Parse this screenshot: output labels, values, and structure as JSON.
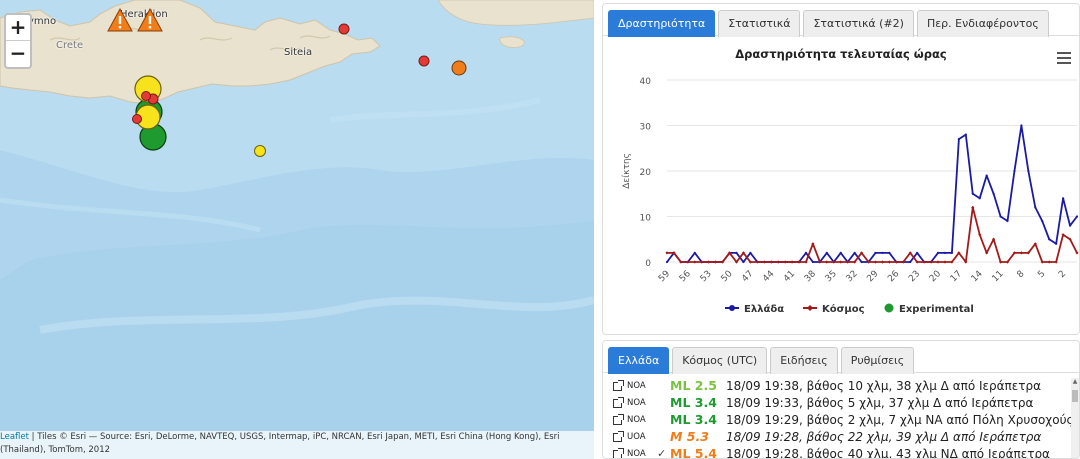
{
  "map": {
    "zoom_in": "+",
    "zoom_out": "−",
    "labels": {
      "rethymno": "ymno",
      "heraklion": "Heraklion",
      "crete": "Crete",
      "siteia": "Siteia"
    },
    "attribution": {
      "leaflet": "Leaflet",
      "text": " | Tiles © Esri — Source: Esri, DeLorme, NAVTEQ, USGS, Intermap, iPC, NRCAN, Esri Japan, METI, Esri China (Hong Kong), Esri (Thailand), TomTom, 2012"
    },
    "colors": {
      "sea": "#b9dcf1",
      "land": "#e9e2cf",
      "red": "#e53935",
      "orange": "#ef7d1a",
      "yellow": "#f7e21b",
      "green": "#1f9a2e"
    }
  },
  "top_tabs": [
    {
      "label": "Δραστηριότητα",
      "active": true
    },
    {
      "label": "Στατιστικά",
      "active": false
    },
    {
      "label": "Στατιστικά (#2)",
      "active": false
    },
    {
      "label": "Περ. Ενδιαφέροντος",
      "active": false
    }
  ],
  "chart_data": {
    "type": "line",
    "title": "Δραστηριότητα τελευταίας ώρας",
    "ylabel": "Δείκτης",
    "xlabel": "",
    "ylim": [
      0,
      40
    ],
    "yticks": [
      0,
      10,
      20,
      30,
      40
    ],
    "x_tick_labels": [
      "59",
      "56",
      "53",
      "50",
      "47",
      "44",
      "41",
      "38",
      "35",
      "32",
      "29",
      "26",
      "23",
      "20",
      "17",
      "14",
      "11",
      "8",
      "5",
      "2"
    ],
    "x_minutes": [
      59,
      58,
      57,
      56,
      55,
      54,
      53,
      52,
      51,
      50,
      49,
      48,
      47,
      46,
      45,
      44,
      43,
      42,
      41,
      40,
      39,
      38,
      37,
      36,
      35,
      34,
      33,
      32,
      31,
      30,
      29,
      28,
      27,
      26,
      25,
      24,
      23,
      22,
      21,
      20,
      19,
      18,
      17,
      16,
      15,
      14,
      13,
      12,
      11,
      10,
      9,
      8,
      7,
      6,
      5,
      4,
      3,
      2,
      1,
      0
    ],
    "grid": true,
    "legend_position": "bottom",
    "series": [
      {
        "name": "Ελλάδα",
        "color": "#1a1aa6",
        "marker": "circle",
        "values": [
          0,
          2,
          0,
          0,
          2,
          0,
          0,
          0,
          0,
          2,
          2,
          0,
          2,
          0,
          0,
          0,
          0,
          0,
          0,
          0,
          2,
          0,
          0,
          2,
          0,
          2,
          0,
          2,
          0,
          0,
          2,
          2,
          2,
          0,
          0,
          0,
          2,
          0,
          0,
          2,
          2,
          2,
          27,
          28,
          15,
          14,
          19,
          15,
          10,
          9,
          20,
          30,
          20,
          12,
          9,
          5,
          4,
          14,
          8,
          10
        ]
      },
      {
        "name": "Κόσμος",
        "color": "#a31a1a",
        "marker": "diamond",
        "values": [
          2,
          2,
          0,
          0,
          0,
          0,
          0,
          0,
          0,
          2,
          0,
          2,
          0,
          0,
          0,
          0,
          0,
          0,
          0,
          0,
          0,
          4,
          0,
          0,
          0,
          0,
          0,
          0,
          2,
          0,
          0,
          0,
          0,
          0,
          0,
          2,
          0,
          0,
          0,
          0,
          0,
          0,
          2,
          0,
          12,
          6,
          2,
          5,
          0,
          0,
          2,
          2,
          2,
          4,
          0,
          0,
          0,
          6,
          5,
          2
        ]
      },
      {
        "name": "Experimental",
        "color": "#1f9a2e",
        "marker": "circle",
        "values": []
      }
    ]
  },
  "bottom_tabs": [
    {
      "label": "Ελλάδα",
      "active": true
    },
    {
      "label": "Κόσμος (UTC)",
      "active": false
    },
    {
      "label": "Ειδήσεις",
      "active": false
    },
    {
      "label": "Ρυθμίσεις",
      "active": false
    }
  ],
  "events": [
    {
      "source": "NOA",
      "check": "",
      "mag": "ML 2.5",
      "mag_color": "#7cc242",
      "italic": false,
      "desc": "18/09 19:38, βάθος 10 χλμ, 38 χλμ Δ από Ιεράπετρα"
    },
    {
      "source": "NOA",
      "check": "",
      "mag": "ML 3.4",
      "mag_color": "#1f9a2e",
      "italic": false,
      "desc": "18/09 19:33, βάθος 5 χλμ, 37 χλμ Δ από Ιεράπετρα"
    },
    {
      "source": "NOA",
      "check": "",
      "mag": "ML 3.4",
      "mag_color": "#1f9a2e",
      "italic": false,
      "desc": "18/09 19:29, βάθος 2 χλμ, 7 χλμ ΝΑ από Πόλη Χρυσοχούς"
    },
    {
      "source": "UOA",
      "check": "",
      "mag": "M 5.3",
      "mag_color": "#ef7d1a",
      "italic": true,
      "desc": "18/09 19:28, βάθος 22 χλμ, 39 χλμ Δ από Ιεράπετρα"
    },
    {
      "source": "NOA",
      "check": "✓",
      "mag": "ML 5.4",
      "mag_color": "#ef7d1a",
      "italic": false,
      "desc": "18/09 19:28, βάθος 40 χλμ, 43 χλμ ΝΔ από Ιεράπετρα"
    }
  ]
}
